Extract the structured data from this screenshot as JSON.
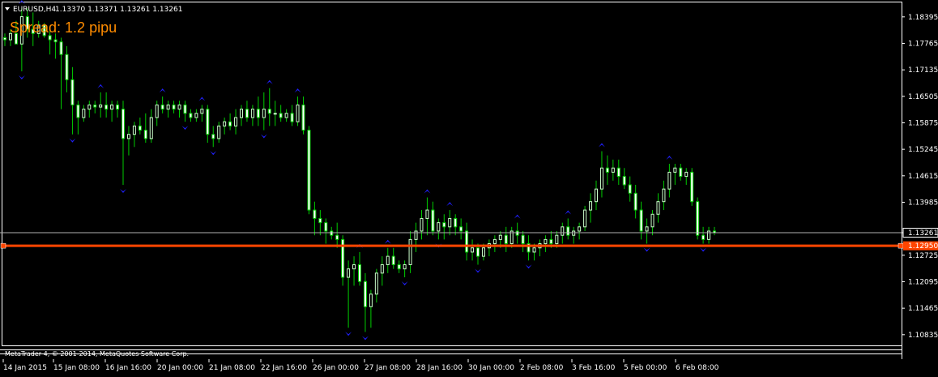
{
  "header": {
    "symbol": "EURUSD,H4",
    "ohlc": "1.13370 1.13371 1.13261 1.13261"
  },
  "overlay": {
    "spread_text": "Spread: 1.2 pipu"
  },
  "footer": {
    "copyright": "MetaTrader 4, © 2001-2014, MetaQuotes Software Corp."
  },
  "colors": {
    "background": "#000000",
    "bull_candle": "#ccffcc",
    "bear_candle": "#ffffff",
    "wick": "#00cc00",
    "fractal_arrow": "#2020ff",
    "level_line": "#ff4500",
    "bid_line": "#b0b0b0",
    "spread_text": "#ff8c00",
    "frame": "#ffffff"
  },
  "price_axis": {
    "ticks": [
      "1.18395",
      "1.17765",
      "1.17135",
      "1.16505",
      "1.15875",
      "1.15245",
      "1.14615",
      "1.13985",
      "1.13261",
      "1.12725",
      "1.12095",
      "1.11465",
      "1.10835"
    ],
    "current_price": "1.13261",
    "level_price": "1.12950"
  },
  "time_axis": {
    "ticks": [
      "14 Jan 2015",
      "15 Jan 08:00",
      "16 Jan 16:00",
      "20 Jan 00:00",
      "21 Jan 08:00",
      "22 Jan 16:00",
      "26 Jan 00:00",
      "27 Jan 08:00",
      "28 Jan 16:00",
      "30 Jan 00:00",
      "2 Feb 08:00",
      "3 Feb 16:00",
      "5 Feb 00:00",
      "6 Feb 08:00"
    ]
  },
  "chart_data": {
    "type": "candlestick",
    "symbol": "EURUSD",
    "timeframe": "H4",
    "ylim": [
      1.106,
      1.187
    ],
    "candles": [
      [
        1.179,
        1.18,
        1.177,
        1.1785
      ],
      [
        1.1785,
        1.181,
        1.177,
        1.18
      ],
      [
        1.18,
        1.183,
        1.178,
        1.1775
      ],
      [
        1.1775,
        1.186,
        1.171,
        1.184
      ],
      [
        1.184,
        1.186,
        1.179,
        1.181
      ],
      [
        1.181,
        1.185,
        1.177,
        1.18
      ],
      [
        1.18,
        1.183,
        1.179,
        1.182
      ],
      [
        1.182,
        1.1825,
        1.179,
        1.1795
      ],
      [
        1.1795,
        1.181,
        1.175,
        1.1785
      ],
      [
        1.1785,
        1.18,
        1.174,
        1.178
      ],
      [
        1.178,
        1.179,
        1.162,
        1.175
      ],
      [
        1.175,
        1.177,
        1.166,
        1.169
      ],
      [
        1.169,
        1.172,
        1.156,
        1.163
      ],
      [
        1.163,
        1.164,
        1.156,
        1.16
      ],
      [
        1.16,
        1.163,
        1.159,
        1.162
      ],
      [
        1.162,
        1.164,
        1.16,
        1.163
      ],
      [
        1.163,
        1.164,
        1.161,
        1.1625
      ],
      [
        1.1625,
        1.166,
        1.16,
        1.163
      ],
      [
        1.163,
        1.166,
        1.16,
        1.162
      ],
      [
        1.162,
        1.164,
        1.159,
        1.163
      ],
      [
        1.163,
        1.164,
        1.16,
        1.162
      ],
      [
        1.162,
        1.164,
        1.144,
        1.155
      ],
      [
        1.155,
        1.158,
        1.151,
        1.156
      ],
      [
        1.156,
        1.159,
        1.153,
        1.158
      ],
      [
        1.158,
        1.16,
        1.156,
        1.157
      ],
      [
        1.157,
        1.161,
        1.154,
        1.155
      ],
      [
        1.155,
        1.162,
        1.154,
        1.16
      ],
      [
        1.16,
        1.164,
        1.158,
        1.163
      ],
      [
        1.163,
        1.165,
        1.161,
        1.162
      ],
      [
        1.162,
        1.164,
        1.16,
        1.163
      ],
      [
        1.163,
        1.164,
        1.161,
        1.162
      ],
      [
        1.162,
        1.164,
        1.16,
        1.163
      ],
      [
        1.163,
        1.164,
        1.159,
        1.161
      ],
      [
        1.161,
        1.162,
        1.159,
        1.16
      ],
      [
        1.16,
        1.162,
        1.159,
        1.161
      ],
      [
        1.161,
        1.163,
        1.159,
        1.162
      ],
      [
        1.162,
        1.163,
        1.154,
        1.156
      ],
      [
        1.156,
        1.158,
        1.153,
        1.155
      ],
      [
        1.155,
        1.159,
        1.154,
        1.158
      ],
      [
        1.158,
        1.16,
        1.156,
        1.159
      ],
      [
        1.159,
        1.161,
        1.157,
        1.158
      ],
      [
        1.158,
        1.162,
        1.156,
        1.16
      ],
      [
        1.16,
        1.163,
        1.158,
        1.162
      ],
      [
        1.162,
        1.164,
        1.159,
        1.16
      ],
      [
        1.16,
        1.163,
        1.158,
        1.162
      ],
      [
        1.162,
        1.165,
        1.158,
        1.16
      ],
      [
        1.16,
        1.166,
        1.157,
        1.162
      ],
      [
        1.162,
        1.167,
        1.158,
        1.161
      ],
      [
        1.161,
        1.164,
        1.158,
        1.161
      ],
      [
        1.161,
        1.163,
        1.159,
        1.16
      ],
      [
        1.16,
        1.162,
        1.159,
        1.161
      ],
      [
        1.161,
        1.163,
        1.158,
        1.159
      ],
      [
        1.159,
        1.165,
        1.158,
        1.163
      ],
      [
        1.163,
        1.165,
        1.156,
        1.157
      ],
      [
        1.157,
        1.158,
        1.137,
        1.138
      ],
      [
        1.138,
        1.14,
        1.132,
        1.136
      ],
      [
        1.136,
        1.138,
        1.132,
        1.135
      ],
      [
        1.135,
        1.136,
        1.13,
        1.133
      ],
      [
        1.133,
        1.134,
        1.131,
        1.132
      ],
      [
        1.132,
        1.135,
        1.129,
        1.131
      ],
      [
        1.131,
        1.132,
        1.12,
        1.122
      ],
      [
        1.122,
        1.126,
        1.11,
        1.124
      ],
      [
        1.124,
        1.127,
        1.12,
        1.125
      ],
      [
        1.125,
        1.128,
        1.12,
        1.121
      ],
      [
        1.121,
        1.123,
        1.109,
        1.115
      ],
      [
        1.115,
        1.119,
        1.11,
        1.118
      ],
      [
        1.118,
        1.124,
        1.116,
        1.123
      ],
      [
        1.123,
        1.127,
        1.12,
        1.125
      ],
      [
        1.125,
        1.129,
        1.123,
        1.127
      ],
      [
        1.127,
        1.129,
        1.124,
        1.125
      ],
      [
        1.125,
        1.126,
        1.123,
        1.124
      ],
      [
        1.124,
        1.126,
        1.122,
        1.125
      ],
      [
        1.125,
        1.133,
        1.123,
        1.131
      ],
      [
        1.131,
        1.135,
        1.128,
        1.133
      ],
      [
        1.133,
        1.138,
        1.131,
        1.136
      ],
      [
        1.136,
        1.141,
        1.132,
        1.138
      ],
      [
        1.138,
        1.14,
        1.132,
        1.133
      ],
      [
        1.133,
        1.136,
        1.131,
        1.135
      ],
      [
        1.135,
        1.137,
        1.131,
        1.134
      ],
      [
        1.134,
        1.138,
        1.132,
        1.136
      ],
      [
        1.136,
        1.137,
        1.132,
        1.134
      ],
      [
        1.134,
        1.136,
        1.131,
        1.133
      ],
      [
        1.133,
        1.135,
        1.126,
        1.128
      ],
      [
        1.128,
        1.131,
        1.126,
        1.129
      ],
      [
        1.129,
        1.13,
        1.125,
        1.127
      ],
      [
        1.127,
        1.13,
        1.126,
        1.129
      ],
      [
        1.129,
        1.131,
        1.127,
        1.13
      ],
      [
        1.13,
        1.132,
        1.128,
        1.131
      ],
      [
        1.131,
        1.133,
        1.129,
        1.132
      ],
      [
        1.132,
        1.134,
        1.128,
        1.13
      ],
      [
        1.13,
        1.134,
        1.129,
        1.133
      ],
      [
        1.133,
        1.135,
        1.13,
        1.132
      ],
      [
        1.132,
        1.133,
        1.128,
        1.13
      ],
      [
        1.13,
        1.132,
        1.126,
        1.128
      ],
      [
        1.128,
        1.13,
        1.126,
        1.129
      ],
      [
        1.129,
        1.131,
        1.127,
        1.13
      ],
      [
        1.13,
        1.132,
        1.128,
        1.131
      ],
      [
        1.131,
        1.133,
        1.129,
        1.13
      ],
      [
        1.13,
        1.133,
        1.129,
        1.132
      ],
      [
        1.132,
        1.135,
        1.13,
        1.134
      ],
      [
        1.134,
        1.136,
        1.131,
        1.132
      ],
      [
        1.132,
        1.134,
        1.13,
        1.133
      ],
      [
        1.133,
        1.135,
        1.131,
        1.134
      ],
      [
        1.134,
        1.139,
        1.133,
        1.138
      ],
      [
        1.138,
        1.142,
        1.135,
        1.14
      ],
      [
        1.14,
        1.145,
        1.138,
        1.143
      ],
      [
        1.143,
        1.152,
        1.141,
        1.148
      ],
      [
        1.148,
        1.151,
        1.144,
        1.147
      ],
      [
        1.147,
        1.15,
        1.145,
        1.148
      ],
      [
        1.148,
        1.15,
        1.144,
        1.146
      ],
      [
        1.146,
        1.148,
        1.143,
        1.144
      ],
      [
        1.144,
        1.146,
        1.14,
        1.142
      ],
      [
        1.142,
        1.144,
        1.136,
        1.138
      ],
      [
        1.138,
        1.14,
        1.131,
        1.133
      ],
      [
        1.133,
        1.136,
        1.13,
        1.134
      ],
      [
        1.134,
        1.138,
        1.132,
        1.137
      ],
      [
        1.137,
        1.142,
        1.135,
        1.14
      ],
      [
        1.14,
        1.145,
        1.138,
        1.143
      ],
      [
        1.143,
        1.149,
        1.141,
        1.147
      ],
      [
        1.147,
        1.149,
        1.144,
        1.148
      ],
      [
        1.148,
        1.149,
        1.145,
        1.146
      ],
      [
        1.146,
        1.148,
        1.144,
        1.147
      ],
      [
        1.147,
        1.148,
        1.139,
        1.14
      ],
      [
        1.14,
        1.141,
        1.131,
        1.132
      ],
      [
        1.132,
        1.134,
        1.13,
        1.131
      ],
      [
        1.131,
        1.134,
        1.13,
        1.133
      ],
      [
        1.133,
        1.134,
        1.132,
        1.1326
      ]
    ]
  }
}
